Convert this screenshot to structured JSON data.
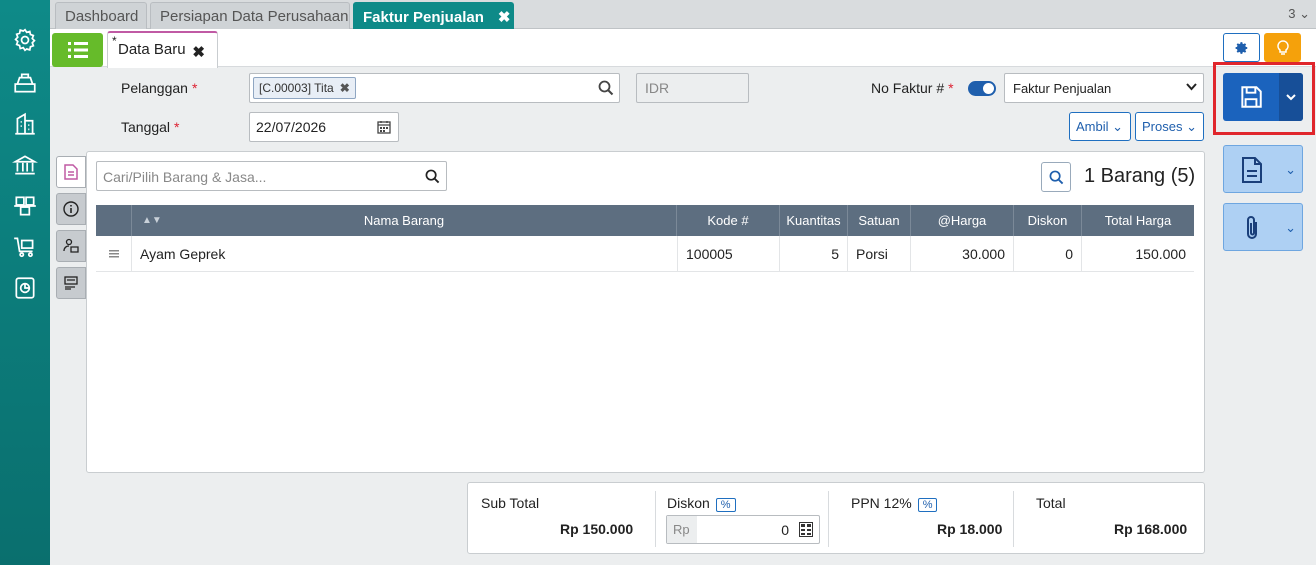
{
  "tabs": [
    {
      "label": "Dashboard"
    },
    {
      "label": "Persiapan Data Perusahaan"
    },
    {
      "label": "Faktur Penjualan",
      "close": "✖"
    }
  ],
  "tab_count": "3 ⌄",
  "doc_tab": {
    "star": "*",
    "label": "Data Baru",
    "close": "✖"
  },
  "form": {
    "pelanggan_label": "Pelanggan",
    "required_mark": "*",
    "customer_chip": "[C.00003] Tita",
    "chip_close": "✖",
    "currency": "IDR",
    "tanggal_label": "Tanggal",
    "date": "22/07/2026",
    "no_faktur_label": "No Faktur #",
    "faktur_type": "Faktur Penjualan",
    "ambil": "Ambil",
    "proses": "Proses"
  },
  "search": {
    "placeholder": "Cari/Pilih Barang & Jasa..."
  },
  "item_count": "1 Barang (5)",
  "table": {
    "headers": [
      "Nama Barang",
      "Kode #",
      "Kuantitas",
      "Satuan",
      "@Harga",
      "Diskon",
      "Total Harga"
    ],
    "rows": [
      {
        "name": "Ayam Geprek",
        "code": "100005",
        "qty": "5",
        "unit": "Porsi",
        "price": "30.000",
        "discount": "0",
        "total": "150.000"
      }
    ]
  },
  "totals": {
    "subtotal_label": "Sub Total",
    "subtotal": "Rp 150.000",
    "diskon_label": "Diskon",
    "pct": "%",
    "rp": "Rp",
    "diskon_value": "0",
    "ppn_label": "PPN 12%",
    "ppn": "Rp 18.000",
    "total_label": "Total",
    "total": "Rp 168.000"
  },
  "colors": {
    "sidebar": "#0e8a88",
    "accent": "#1b63bd",
    "highlight": "#e0262c",
    "list_button": "#66bb2a"
  }
}
